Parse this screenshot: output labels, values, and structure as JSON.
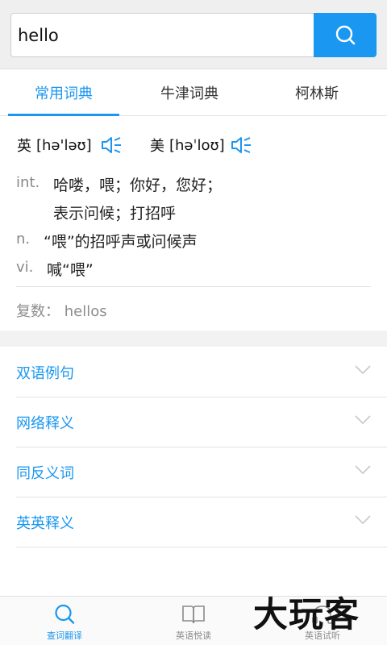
{
  "search": {
    "query": "hello"
  },
  "tabs": [
    {
      "label": "常用词典"
    },
    {
      "label": "牛津词典"
    },
    {
      "label": "柯林斯"
    }
  ],
  "entry": {
    "uk": {
      "label": "英",
      "phonetic": "[hə'ləʊ]"
    },
    "us": {
      "label": "美",
      "phonetic": "[həˈloʊ]"
    },
    "definitions": [
      {
        "pos": "int.",
        "text": "哈喽，喂；你好，您好；"
      },
      {
        "pos": "",
        "text": "表示问候；打招呼"
      },
      {
        "pos": "n.",
        "text": "“喂”的招呼声或问候声"
      },
      {
        "pos": "vi.",
        "text": "喊“喂”"
      }
    ],
    "plural": "复数： hellos"
  },
  "sections": [
    {
      "label": "双语例句"
    },
    {
      "label": "网络释义"
    },
    {
      "label": "同反义词"
    },
    {
      "label": "英英释义"
    }
  ],
  "bottom_nav": [
    {
      "label": "查词翻译"
    },
    {
      "label": "英语悦读"
    },
    {
      "label": "英语试听"
    }
  ],
  "watermark": "大玩客",
  "colors": {
    "accent": "#1a97f0"
  }
}
